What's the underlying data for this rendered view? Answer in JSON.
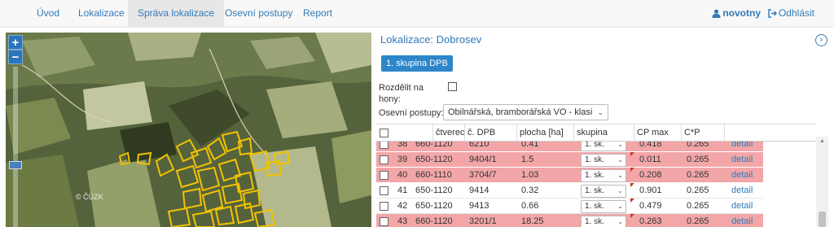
{
  "nav": {
    "items": [
      {
        "label": "Úvod",
        "active": false
      },
      {
        "label": "Lokalizace",
        "active": false
      },
      {
        "label": "Správa lokalizace",
        "active": true
      },
      {
        "label": "Osevní postupy",
        "active": false
      },
      {
        "label": "Report",
        "active": false
      }
    ],
    "user": "novotny",
    "logout": "Odhlásit"
  },
  "map": {
    "watermark": "© ČÚZK",
    "zoom_in": "+",
    "zoom_out": "−"
  },
  "panel": {
    "title": "Lokalizace: Dobrosev",
    "collapse_icon": "chevron-right-circle-icon",
    "group_button": "1. skupina DPB",
    "split_label": "Rozdělit na hony:",
    "split_checked": false,
    "sowing_label": "Osevní postupy:",
    "sowing_value": "Obilnářská, bramborářská VO - klasi"
  },
  "table": {
    "columns": [
      "čtverec",
      "č. DPB",
      "plocha [ha]",
      "skupina",
      "CP max",
      "C*P"
    ],
    "rows": [
      {
        "num": "38",
        "ctverec": "660-1120",
        "dpb": "6210",
        "plocha": "0.41",
        "skupina": "1. sk.",
        "cpmax": "0.418",
        "cp": "0.265",
        "action": "detail",
        "status": "warn"
      },
      {
        "num": "39",
        "ctverec": "650-1120",
        "dpb": "9404/1",
        "plocha": "1.5",
        "skupina": "1. sk.",
        "cpmax": "0.011",
        "cp": "0.265",
        "action": "detail",
        "status": "warn"
      },
      {
        "num": "40",
        "ctverec": "660-1110",
        "dpb": "3704/7",
        "plocha": "1.03",
        "skupina": "1. sk.",
        "cpmax": "0.208",
        "cp": "0.265",
        "action": "detail",
        "status": "warn"
      },
      {
        "num": "41",
        "ctverec": "650-1120",
        "dpb": "9414",
        "plocha": "0.32",
        "skupina": "1. sk.",
        "cpmax": "0.901",
        "cp": "0.265",
        "action": "detail",
        "status": "ok"
      },
      {
        "num": "42",
        "ctverec": "650-1120",
        "dpb": "9413",
        "plocha": "0.66",
        "skupina": "1. sk.",
        "cpmax": "0.479",
        "cp": "0.265",
        "action": "detail",
        "status": "ok"
      },
      {
        "num": "43",
        "ctverec": "660-1120",
        "dpb": "3201/1",
        "plocha": "18.25",
        "skupina": "1. sk.",
        "cpmax": "0.263",
        "cp": "0.265",
        "action": "detail",
        "status": "warn"
      }
    ]
  },
  "colors": {
    "link": "#337ab7",
    "warn_row": "#f2a6a8",
    "button": "#2d86c9",
    "parcel_outline": "#f2c200"
  }
}
